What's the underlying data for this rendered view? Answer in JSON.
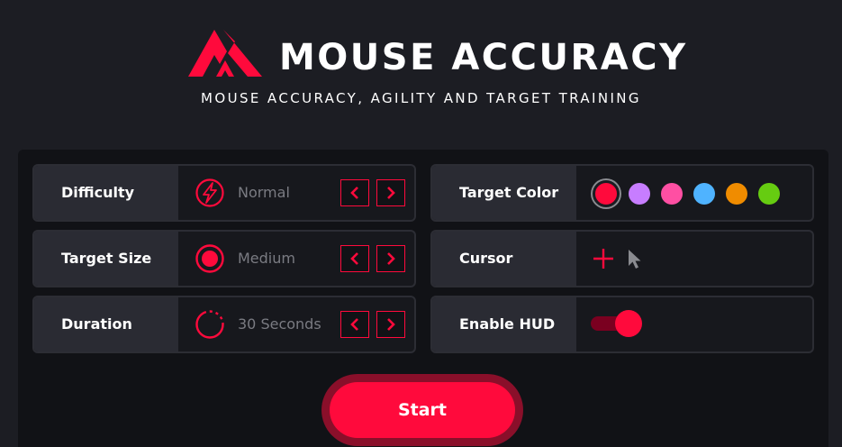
{
  "header": {
    "title": "MOUSE ACCURACY",
    "subtitle": "MOUSE ACCURACY, AGILITY AND TARGET TRAINING",
    "logo_icon": "double-chevron-up-logo"
  },
  "colors": {
    "accent": "#ff0a3c",
    "background": "#1c1d23",
    "panel": "#111216",
    "label_bg": "#2a2b33",
    "value_text": "#7a7b82"
  },
  "settings": {
    "difficulty": {
      "label": "Difficulty",
      "value": "Normal",
      "icon": "lightning-icon"
    },
    "target_size": {
      "label": "Target Size",
      "value": "Medium",
      "icon": "target-circle-icon"
    },
    "duration": {
      "label": "Duration",
      "value": "30 Seconds",
      "icon": "timer-ring-icon"
    },
    "target_color": {
      "label": "Target Color",
      "options": [
        "#ff0a3c",
        "#c77dff",
        "#ff4fa3",
        "#4fb3ff",
        "#f08c00",
        "#66cc11"
      ],
      "selected": "#ff0a3c"
    },
    "cursor": {
      "label": "Cursor",
      "options": [
        "crosshair-icon",
        "arrow-pointer-icon"
      ]
    },
    "hud": {
      "label": "Enable HUD",
      "enabled": true
    }
  },
  "start": {
    "label": "Start"
  }
}
